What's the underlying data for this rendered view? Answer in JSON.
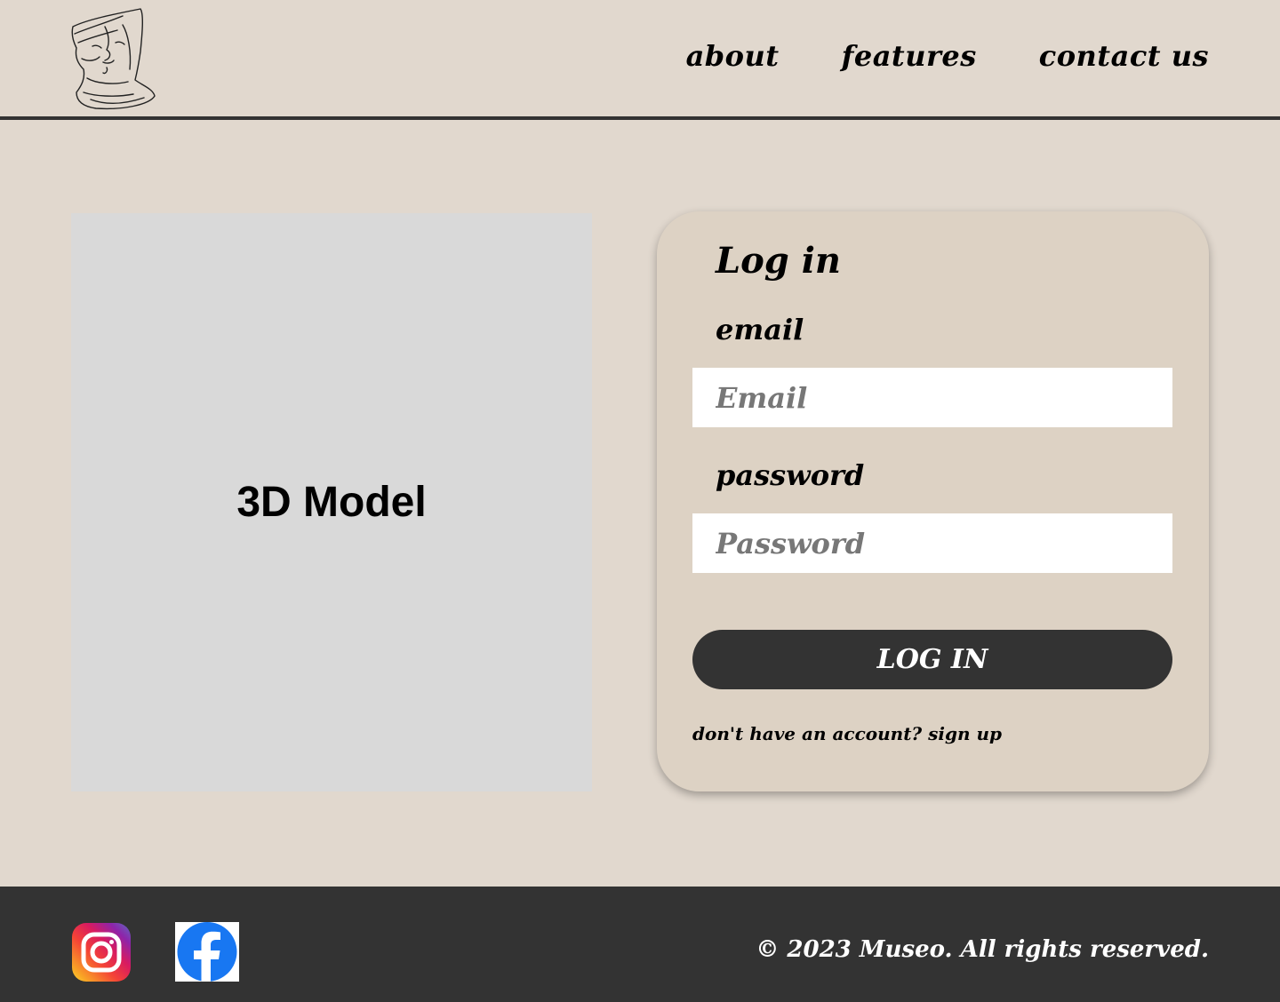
{
  "header": {
    "logo": "bust-sketch-logo",
    "nav": [
      {
        "label": "about"
      },
      {
        "label": "features"
      },
      {
        "label": "contact us"
      }
    ]
  },
  "main": {
    "model_placeholder": "3D Model"
  },
  "login": {
    "title": "Log in",
    "email_label": "email",
    "email_placeholder": "Email",
    "password_label": "password",
    "password_placeholder": "Password",
    "button_label": "LOG IN",
    "signup_prompt": "don't have an account?",
    "signup_link": "sign up"
  },
  "footer": {
    "social": [
      {
        "icon": "instagram-icon"
      },
      {
        "icon": "facebook-icon"
      }
    ],
    "copyright": "© 2023 Museo. All rights reserved."
  },
  "colors": {
    "background": "#e1d8ce",
    "card": "#ddd2c4",
    "dark": "#333333",
    "placeholder_box": "#d9d9d9",
    "facebook_blue": "#1877f2"
  }
}
